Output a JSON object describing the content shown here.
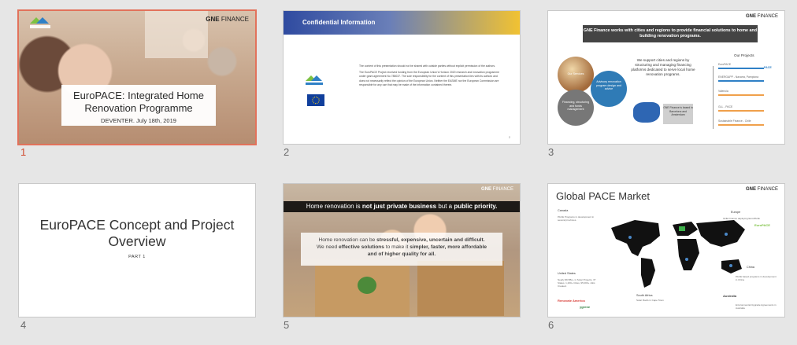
{
  "slides": [
    {
      "number": "1",
      "logo_text": "EuroPACE",
      "brand_bold": "GNE",
      "brand_rest": "FINANCE",
      "title": "EuroPACE: Integrated Home Renovation Programme",
      "date": "DEVENTER. July 18th, 2019"
    },
    {
      "number": "2",
      "header": "Confidential Information",
      "logo_text": "EuroPACE",
      "para1": "The content of this presentation should not be shared with outside parties without explicit permission of the authors.",
      "para2": "The EuroPACE Project received funding from the European Union's Horizon 2020 research and innovation programme under grant agreement No 785037. The sole responsibility for the content of this presentation lies with its authors and does not necessarily reflect the opinion of the European Union. Neither the EASME nor the European Commission are responsible for any use that may be made of the information contained therein.",
      "page_no": "2"
    },
    {
      "number": "3",
      "brand_bold": "GNE",
      "brand_rest": "FINANCE",
      "headline": "GNE Finance works with cities and regions to provide financial solutions to home and building renovation programs.",
      "circle1": "Our Services",
      "circle2": "Advisory renovation program design and advice",
      "circle3": "Financing, structuring and funds management",
      "mid_text": "We support cities and regions by structuring and managing financing platforms dedicated to serve local home renovation programs.",
      "box_text": "GNE Finance is based in Barcelona and Amsterdam",
      "projects_title": "Our Projects",
      "projects": [
        "EuroPACE",
        "ENERGAPP - Navarra, Pamplona",
        "Valencia",
        "GLL - PACE",
        "Sustainable Finance - Chile"
      ],
      "vertical_label": "Renovation and PACE Experience",
      "badge1": "PACE"
    },
    {
      "number": "4",
      "title": "EuroPACE Concept and Project Overview",
      "subtitle": "PART 1"
    },
    {
      "number": "5",
      "brand_bold": "GNE",
      "brand_rest": "FINANCE",
      "banner_pre": "Home renovation is ",
      "banner_b1": "not just private business",
      "banner_mid": " but a ",
      "banner_b2": "public priority.",
      "card_line1_pre": "Home renovation can be ",
      "card_line1_b": "stressful, expensive, uncertain and difficult.",
      "card_line2_pre": "We need ",
      "card_line2_b": "effective solutions",
      "card_line2_mid": " to make it ",
      "card_line2_b2": "simpler, faster, more affordable",
      "card_line3": "and of higher quality for all."
    },
    {
      "number": "6",
      "title": "Global PACE Market",
      "brand_bold": "GNE",
      "brand_rest": "FINANCE",
      "regions": {
        "canada": "Canada",
        "europe": "Europe",
        "us": "United States",
        "china": "China",
        "south_africa": "South Africa",
        "australia": "Australia"
      },
      "canada_text": "PACE Programs in development in several provinces.",
      "europe_text": "GNE Finance deploying EuroPACE",
      "us_text": "Nearly $6.5Bn+ in Solar Projects, 37 States, 1,200+ Cities, 95,000+ Jobs Created.",
      "china_text": "PACE based programs in development in China",
      "sa_text": "Solar Roofs in Cape Town",
      "aus_text": "Environmental Upgrade Agreements in Australia",
      "europace_logo": "EuroPACE",
      "renovate_logo": "Renovate America",
      "ygrene_logo": "ygrene",
      "australia_logo": "Australia"
    }
  ],
  "colors": {
    "selected_border": "#e2725b",
    "accent_blue": "#2f4ba0",
    "accent_yellow": "#f1c232"
  }
}
